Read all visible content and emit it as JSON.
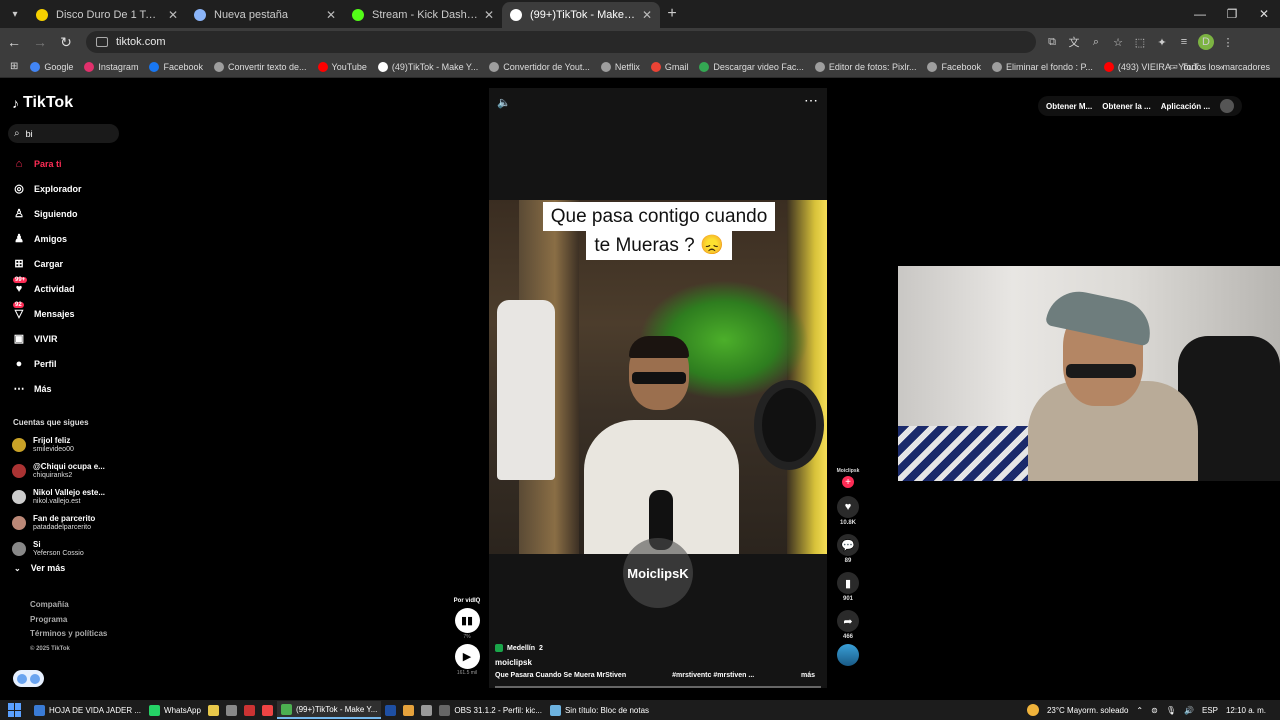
{
  "browser": {
    "tabs": [
      {
        "title": "Disco Duro De 1 Tera | Mercado",
        "color": "#f5d000",
        "active": false
      },
      {
        "title": "Nueva pestaña",
        "color": "#8ab4f8",
        "active": false
      },
      {
        "title": "Stream - Kick Dashboard",
        "color": "#53fc18",
        "active": false
      },
      {
        "title": "(99+)TikTok - Make Your Da",
        "color": "#ffffff",
        "active": true
      }
    ],
    "url": "tiktok.com",
    "profile_letter": "D",
    "bookmarks": [
      {
        "label": "Google",
        "color": "#4285f4"
      },
      {
        "label": "Instagram",
        "color": "#e1306c"
      },
      {
        "label": "Facebook",
        "color": "#1877f2"
      },
      {
        "label": "Convertir texto de...",
        "color": "#9e9e9e"
      },
      {
        "label": "YouTube",
        "color": "#ff0000"
      },
      {
        "label": "(49)TikTok - Make Y...",
        "color": "#ffffff"
      },
      {
        "label": "Convertidor de Yout...",
        "color": "#9e9e9e"
      },
      {
        "label": "Netflix",
        "color": "#9e9e9e"
      },
      {
        "label": "Gmail",
        "color": "#ea4335"
      },
      {
        "label": "Descargar video Fac...",
        "color": "#34a853"
      },
      {
        "label": "Editor de fotos: Pixlr...",
        "color": "#9e9e9e"
      },
      {
        "label": "Facebook",
        "color": "#9e9e9e"
      },
      {
        "label": "Eliminar el fondo : P...",
        "color": "#9e9e9e"
      },
      {
        "label": "(493) VIEIRA - YouT...",
        "color": "#ff0000"
      }
    ],
    "all_bookmarks": "Todos los marcadores"
  },
  "tiktok": {
    "logo": "TikTok",
    "search_value": "bi",
    "nav": [
      {
        "label": "Para ti",
        "icon": "home-icon",
        "glyph": "⌂"
      },
      {
        "label": "Explorador",
        "icon": "compass-icon",
        "glyph": "◎"
      },
      {
        "label": "Siguiendo",
        "icon": "following-icon",
        "glyph": "♙"
      },
      {
        "label": "Amigos",
        "icon": "friends-icon",
        "glyph": "♟"
      },
      {
        "label": "Cargar",
        "icon": "upload-icon",
        "glyph": "⊞"
      },
      {
        "label": "Actividad",
        "icon": "activity-icon",
        "glyph": "♥",
        "badge": "99+"
      },
      {
        "label": "Mensajes",
        "icon": "messages-icon",
        "glyph": "▽",
        "badge": "92"
      },
      {
        "label": "VIVIR",
        "icon": "live-icon",
        "glyph": "▣"
      },
      {
        "label": "Perfil",
        "icon": "profile-icon",
        "glyph": "●"
      },
      {
        "label": "Más",
        "icon": "more-icon",
        "glyph": "⋯"
      }
    ],
    "following_header": "Cuentas que sigues",
    "following": [
      {
        "name": "Frijol feliz",
        "user": "smilevideo00",
        "color": "#c9a227"
      },
      {
        "name": "@Chiqui ocupa e...",
        "user": "chiquiranks2",
        "color": "#a33"
      },
      {
        "name": "Nikol Vallejo este...",
        "user": "nikol.vallejo.est",
        "color": "#ccc"
      },
      {
        "name": "Fan de parcerito",
        "user": "patadadelparcerito",
        "color": "#b87"
      },
      {
        "name": "Si",
        "user": "Yeferson Cossio",
        "color": "#888"
      }
    ],
    "see_more": "Ver más",
    "footer": [
      "Compañía",
      "Programa",
      "Términos y políticas"
    ],
    "copyright": "© 2025 TikTok",
    "video": {
      "caption_line1": "Que pasa contigo cuando",
      "caption_line2": "te Mueras ? 😞",
      "watermark_a": "MoiclipsK",
      "tagline": "Medellín",
      "tagline_count": "2",
      "author": "moiclipsk",
      "description": "Que Pasara Cuando Se Muera MrStiven",
      "hashtags": "#mrstiventc  #mrstiven  ...",
      "more": "más"
    },
    "actions": {
      "avatar_label": "Moiclipsk",
      "likes": "10.8K",
      "comments": "89",
      "saves": "901",
      "shares": "466"
    },
    "left_ctl": {
      "label": "Por vidIQ",
      "pct": "7%",
      "time": "161.5 mil"
    },
    "topright": [
      "Obtener M...",
      "Obtener la ...",
      "Aplicación ..."
    ]
  },
  "taskbar": {
    "items": [
      {
        "label": "HOJA DE VIDA JADER ...",
        "color": "#3a7bd5",
        "active": false
      },
      {
        "label": "WhatsApp",
        "color": "#25d366",
        "active": false
      },
      {
        "label": "(99+)TikTok - Make Y...",
        "color": "#4caf50",
        "active": true
      },
      {
        "label": "OBS 31.1.2 - Perfil: kic...",
        "color": "#666",
        "active": false
      },
      {
        "label": "Sin título: Bloc de notas",
        "color": "#6db3e0",
        "active": false
      }
    ],
    "weather": "23°C  Mayorm. soleado",
    "lang": "ESP",
    "time": "12:10 a. m."
  }
}
